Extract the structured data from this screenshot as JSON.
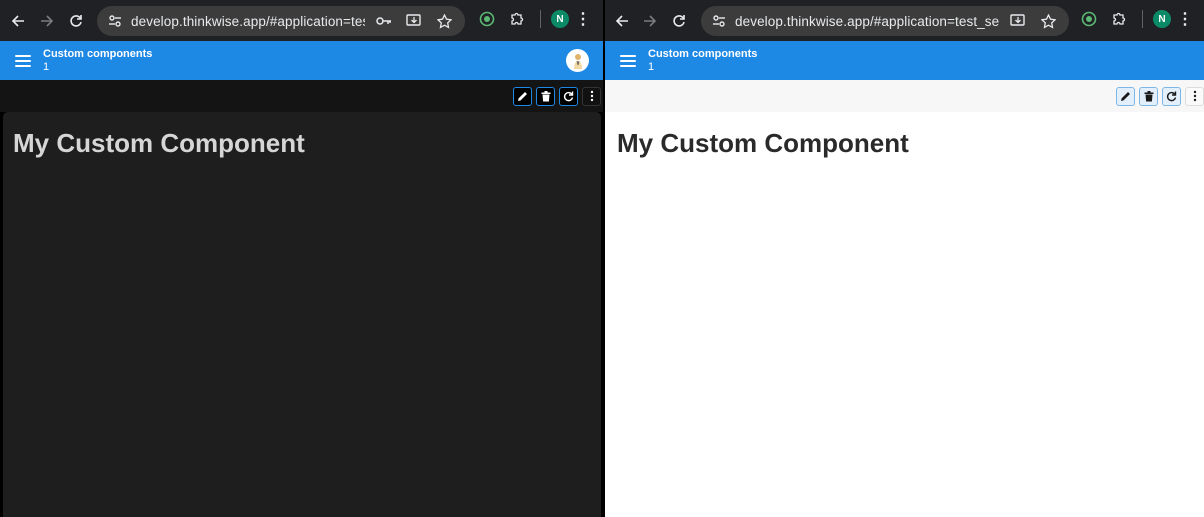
{
  "left": {
    "browser": {
      "url": "develop.thinkwise.app/#application=test_se/subj...",
      "profile_initial": "N"
    },
    "app": {
      "title": "Custom components",
      "subtitle": "1"
    },
    "content": {
      "heading": "My Custom Component"
    },
    "theme": {
      "header": "#1e88e5",
      "background": "#1e1e1e",
      "heading_color": "#d6d6d6"
    }
  },
  "right": {
    "browser": {
      "url": "develop.thinkwise.app/#application=test_se/subject=...",
      "profile_initial": "N"
    },
    "app": {
      "title": "Custom components",
      "subtitle": "1"
    },
    "content": {
      "heading": "My Custom Component"
    },
    "theme": {
      "header": "#1e88e5",
      "background": "#ffffff",
      "heading_color": "#2a2a2a"
    }
  },
  "icons": {
    "back": "arrow-left-icon",
    "forward": "arrow-right-icon",
    "reload": "reload-icon",
    "site_info": "tune-icon",
    "password": "key-icon",
    "install": "install-app-icon",
    "bookmark": "star-icon",
    "extension": "puzzle-icon",
    "edit": "pencil-icon",
    "delete": "trash-icon",
    "refresh": "refresh-icon",
    "more": "more-vertical-icon"
  }
}
